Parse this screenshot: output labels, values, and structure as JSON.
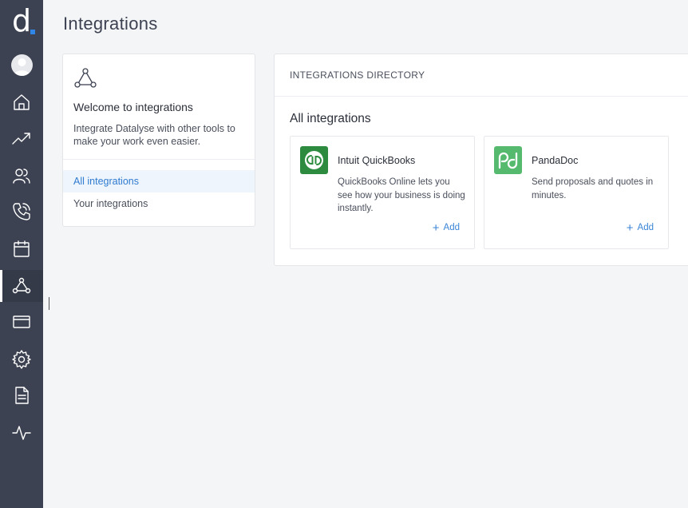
{
  "brand": {
    "logo_letter": "d",
    "accent": "#2f86e4",
    "sidebar_bg": "#3d4252"
  },
  "sidebar": {
    "items": [
      {
        "name": "home-icon",
        "active": false
      },
      {
        "name": "trending-up-icon",
        "active": false
      },
      {
        "name": "users-icon",
        "active": false
      },
      {
        "name": "phone-icon",
        "active": false
      },
      {
        "name": "calendar-icon",
        "active": false
      },
      {
        "name": "integrations-icon",
        "active": true
      },
      {
        "name": "credit-card-icon",
        "active": false
      },
      {
        "name": "settings-gear-icon",
        "active": false
      },
      {
        "name": "document-icon",
        "active": false
      },
      {
        "name": "activity-icon",
        "active": false
      }
    ]
  },
  "page": {
    "title": "Integrations"
  },
  "welcome": {
    "title": "Welcome to integrations",
    "description": "Integrate Datalyse with other tools to make your work even easier.",
    "menu": [
      {
        "label": "All integrations",
        "active": true
      },
      {
        "label": "Your integrations",
        "active": false
      }
    ]
  },
  "directory": {
    "header": "INTEGRATIONS DIRECTORY",
    "subtitle": "All integrations",
    "cards": [
      {
        "name": "Intuit QuickBooks",
        "description": "QuickBooks Online lets you see how your business is doing instantly.",
        "add_label": "Add",
        "logo_color": "#2c8b3e",
        "logo_icon": "quickbooks-icon"
      },
      {
        "name": "PandaDoc",
        "description": "Send proposals and quotes in minutes.",
        "add_label": "Add",
        "logo_color": "#55b96e",
        "logo_icon": "pandadoc-icon"
      }
    ]
  }
}
